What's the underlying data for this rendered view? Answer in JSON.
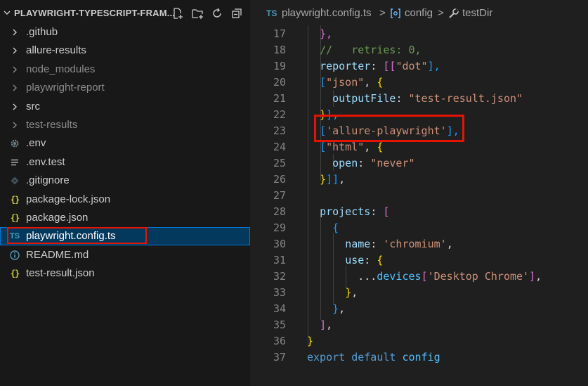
{
  "explorer": {
    "title": "PLAYWRIGHT-TYPESCRIPT-FRAM...",
    "items": [
      {
        "label": ".github",
        "icon": "chevron-right-icon",
        "dim": false
      },
      {
        "label": "allure-results",
        "icon": "chevron-right-icon",
        "dim": false
      },
      {
        "label": "node_modules",
        "icon": "chevron-right-icon",
        "dim": true
      },
      {
        "label": "playwright-report",
        "icon": "chevron-right-icon",
        "dim": true
      },
      {
        "label": "src",
        "icon": "chevron-right-icon",
        "dim": false
      },
      {
        "label": "test-results",
        "icon": "chevron-right-icon",
        "dim": true
      },
      {
        "label": ".env",
        "icon": "gear-icon",
        "dim": false
      },
      {
        "label": ".env.test",
        "icon": "lines-icon",
        "dim": false
      },
      {
        "label": ".gitignore",
        "icon": "git-diamond-icon",
        "dim": false
      },
      {
        "label": "package-lock.json",
        "icon": "json-icon",
        "dim": false
      },
      {
        "label": "package.json",
        "icon": "json-icon",
        "dim": false
      },
      {
        "label": "playwright.config.ts",
        "icon": "ts-icon",
        "dim": false
      },
      {
        "label": "README.md",
        "icon": "info-icon",
        "dim": false
      },
      {
        "label": "test-result.json",
        "icon": "json-icon",
        "dim": false
      }
    ],
    "json_glyph": "{}",
    "ts_glyph": "TS"
  },
  "breadcrumb": {
    "file_badge": "TS",
    "file": "playwright.config.ts",
    "symbol": "config",
    "property": "testDir",
    "separator": ">"
  },
  "code": {
    "line_numbers": [
      "17",
      "18",
      "19",
      "20",
      "21",
      "22",
      "23",
      "24",
      "25",
      "26",
      "27",
      "28",
      "29",
      "30",
      "31",
      "32",
      "33",
      "34",
      "35",
      "36",
      "37"
    ],
    "tokens": {
      "l17": "},",
      "l18": "//   retries: 0,",
      "l19a": "reporter",
      "l19b": ": ",
      "l19c": "[[",
      "l19d": "\"dot\"",
      "l19e": "],",
      "l20a": "[",
      "l20b": "\"json\"",
      "l20c": ", ",
      "l20d": "{",
      "l21a": "outputFile",
      "l21b": ": ",
      "l21c": "\"test-result.json\"",
      "l22a": "}",
      "l22b": "],",
      "l23a": "[",
      "l23b": "'allure-playwright'",
      "l23c": "],",
      "l24a": "[",
      "l24b": "\"html\"",
      "l24c": ", ",
      "l24d": "{",
      "l25a": "open",
      "l25b": ": ",
      "l25c": "\"never\"",
      "l26a": "}",
      "l26b": "]]",
      "l26c": ",",
      "l28a": "projects",
      "l28b": ": ",
      "l28c": "[",
      "l29": "{",
      "l30a": "name",
      "l30b": ": ",
      "l30c": "'chromium'",
      "l30d": ",",
      "l31a": "use",
      "l31b": ": ",
      "l31c": "{",
      "l32a": "...",
      "l32b": "devices",
      "l32c": "[",
      "l32d": "'Desktop Chrome'",
      "l32e": "]",
      "l32f": ",",
      "l33a": "}",
      "l33b": ",",
      "l34a": "}",
      "l34b": ",",
      "l35a": "]",
      "l35b": ",",
      "l36": "}",
      "l37a": "export",
      "l37b": "default",
      "l37c": "config"
    }
  },
  "colors": {
    "highlight_box": "#e51400",
    "selection": "#04395e",
    "sidebar_bg": "#181818",
    "editor_bg": "#1f1f1f"
  }
}
